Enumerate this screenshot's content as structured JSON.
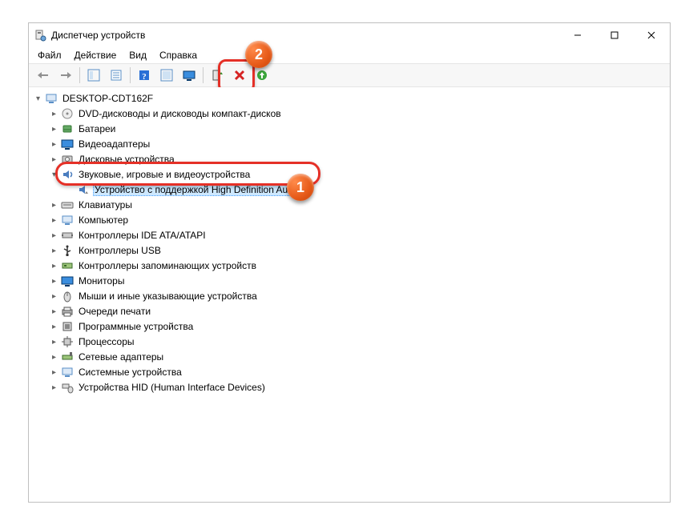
{
  "window": {
    "title": "Диспетчер устройств"
  },
  "menu": {
    "file": "Файл",
    "action": "Действие",
    "view": "Вид",
    "help": "Справка"
  },
  "tree": {
    "root": "DESKTOP-CDT162F",
    "items": [
      "DVD-дисководы и дисководы компакт-дисков",
      "Батареи",
      "Видеоадаптеры",
      "Дисковые устройства",
      "Звуковые, игровые и видеоустройства",
      "Клавиатуры",
      "Компьютер",
      "Контроллеры IDE ATA/ATAPI",
      "Контроллеры USB",
      "Контроллеры запоминающих устройств",
      "Мониторы",
      "Мыши и иные указывающие устройства",
      "Очереди печати",
      "Программные устройства",
      "Процессоры",
      "Сетевые адаптеры",
      "Системные устройства",
      "Устройства HID (Human Interface Devices)"
    ],
    "audio_child": "Устройство с поддержкой High Definition Audio"
  },
  "badges": {
    "one": "1",
    "two": "2"
  }
}
